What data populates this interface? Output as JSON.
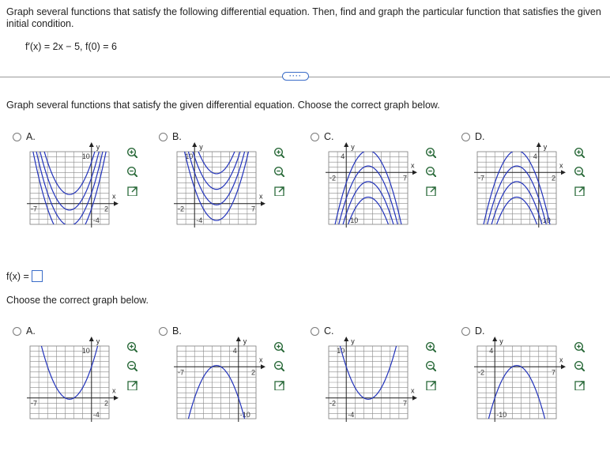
{
  "instructions": "Graph several functions that satisfy the following differential equation. Then, find and graph the particular function that satisfies the given initial condition.",
  "equation": "f′(x) = 2x − 5, f(0) = 6",
  "more_button": "····",
  "question1": "Graph several functions that satisfy the given differential equation. Choose the correct graph below.",
  "fx_label": "f(x) =",
  "fx_value": "",
  "question2": "Choose the correct graph below.",
  "option_labels": [
    "A.",
    "B.",
    "C.",
    "D."
  ],
  "axis_labels": {
    "x": "x",
    "y": "y"
  },
  "colors": {
    "curve": "#2233bb",
    "grid": "#8a8a8a",
    "link": "#3a6cc8"
  },
  "icons": [
    "zoom-in-icon",
    "zoom-out-icon",
    "popout-icon"
  ],
  "set1": [
    {
      "label": "A.",
      "tick_labels": {
        "xmin": "-7",
        "xmax": "2",
        "ymax": "10",
        "ymin": "-4"
      }
    },
    {
      "label": "B.",
      "tick_labels": {
        "xmin": "-2",
        "xmax": "7",
        "ymax": "10",
        "ymin": "-4"
      }
    },
    {
      "label": "C.",
      "tick_labels": {
        "xmin": "-2",
        "xmax": "7",
        "ymax": "4",
        "ymin": "-10"
      }
    },
    {
      "label": "D.",
      "tick_labels": {
        "xmin": "-7",
        "xmax": "2",
        "ymax": "4",
        "ymin": "-10"
      }
    }
  ],
  "set2": [
    {
      "label": "A.",
      "tick_labels": {
        "xmin": "-7",
        "xmax": "2",
        "ymax": "10",
        "ymin": "-4"
      }
    },
    {
      "label": "B.",
      "tick_labels": {
        "xmin": "-7",
        "xmax": "2",
        "ymax": "4",
        "ymin": "-10"
      }
    },
    {
      "label": "C.",
      "tick_labels": {
        "xmin": "-2",
        "xmax": "7",
        "ymax": "10",
        "ymin": "-4"
      }
    },
    {
      "label": "D.",
      "tick_labels": {
        "xmin": "-2",
        "xmax": "7",
        "ymax": "4",
        "ymin": "-10"
      }
    }
  ],
  "chart_data": [
    {
      "type": "line",
      "panel": "set1-A",
      "xlim": [
        -7,
        2
      ],
      "ylim": [
        -4,
        10
      ],
      "series": [
        {
          "values": "y = x^2 + 5x + c",
          "c": [
            -1,
            2,
            5,
            8
          ]
        }
      ]
    },
    {
      "type": "line",
      "panel": "set1-B",
      "xlim": [
        -2,
        7
      ],
      "ylim": [
        -4,
        10
      ],
      "series": [
        {
          "values": "y = x^2 - 5x + c",
          "c": [
            3,
            6,
            9,
            12
          ]
        }
      ]
    },
    {
      "type": "line",
      "panel": "set1-C",
      "xlim": [
        -2,
        7
      ],
      "ylim": [
        -10,
        4
      ],
      "series": [
        {
          "values": "y = -x^2 + 5x + c",
          "c": [
            -11,
            -8,
            -5,
            -2
          ]
        }
      ]
    },
    {
      "type": "line",
      "panel": "set1-D",
      "xlim": [
        -7,
        2
      ],
      "ylim": [
        -10,
        4
      ],
      "series": [
        {
          "values": "y = -x^2 - 5x + c",
          "c": [
            -11,
            -8,
            -5,
            -2
          ]
        }
      ]
    },
    {
      "type": "line",
      "panel": "set2-A",
      "xlim": [
        -7,
        2
      ],
      "ylim": [
        -4,
        10
      ],
      "series": [
        {
          "values": "y = x^2 + 5x + 6"
        }
      ]
    },
    {
      "type": "line",
      "panel": "set2-B",
      "xlim": [
        -7,
        2
      ],
      "ylim": [
        -10,
        4
      ],
      "series": [
        {
          "values": "y = -x^2 - 5x - 6"
        }
      ]
    },
    {
      "type": "line",
      "panel": "set2-C",
      "xlim": [
        -2,
        7
      ],
      "ylim": [
        -4,
        10
      ],
      "series": [
        {
          "values": "y = x^2 - 5x + 6"
        }
      ]
    },
    {
      "type": "line",
      "panel": "set2-D",
      "xlim": [
        -2,
        7
      ],
      "ylim": [
        -10,
        4
      ],
      "series": [
        {
          "values": "y = -x^2 + 5x - 6"
        }
      ]
    }
  ]
}
